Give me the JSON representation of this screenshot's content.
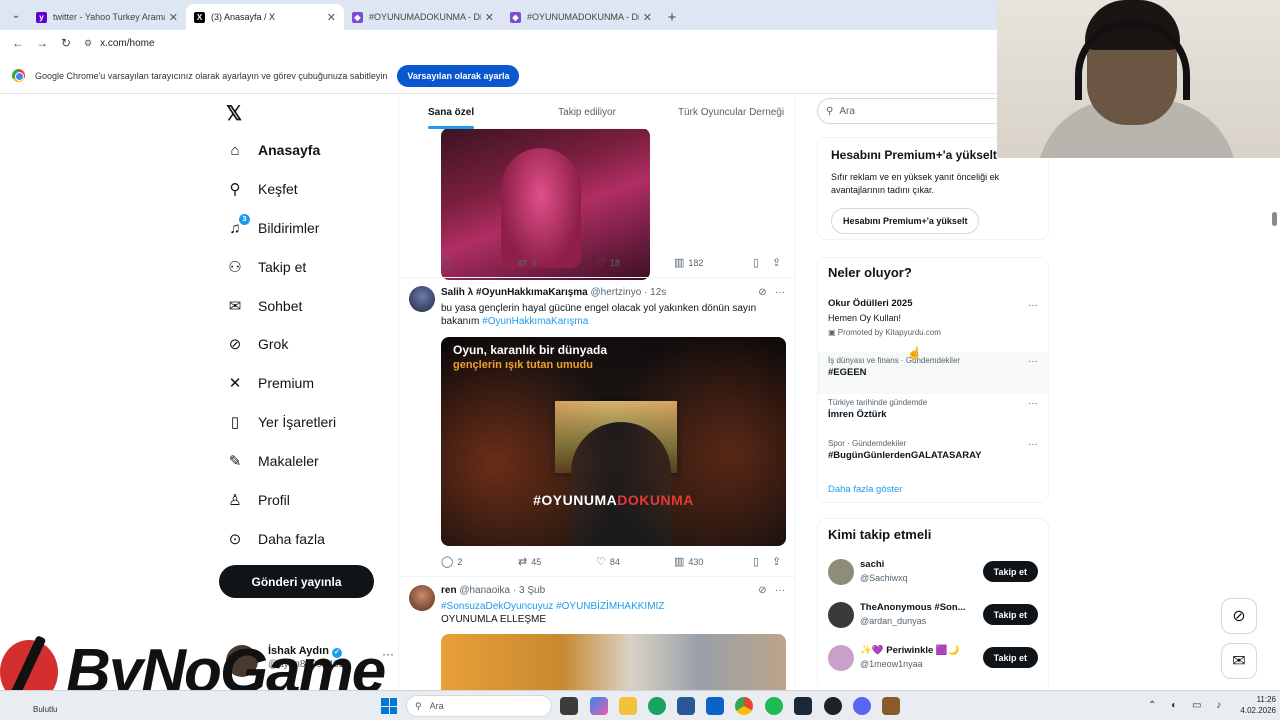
{
  "browser": {
    "tabs": [
      {
        "title": "twitter - Yahoo Turkey Arama Sonuçları",
        "favicon_color": "#6001d2",
        "favicon_glyph": "y!"
      },
      {
        "title": "(3) Anasayfa / X",
        "favicon_color": "#000000",
        "favicon_glyph": "X"
      },
      {
        "title": "#OYUNUMADOKUNMA - Dijital",
        "favicon_color": "#7a4fd6",
        "favicon_glyph": "🎮"
      },
      {
        "title": "#OYUNUMADOKUNMA - Dijital",
        "favicon_color": "#7a4fd6",
        "favicon_glyph": "🎮"
      }
    ],
    "url": "x.com/home",
    "infobar_text": "Google Chrome'u varsayılan tarayıcınız olarak ayarlayın ve görev çubuğunuza sabitleyin",
    "infobar_button": "Varsayılan olarak ayarla"
  },
  "nav": {
    "items": [
      {
        "label": "Anasayfa",
        "icon": "home-icon",
        "glyph": "⌂"
      },
      {
        "label": "Keşfet",
        "icon": "search-icon",
        "glyph": "⚲"
      },
      {
        "label": "Bildirimler",
        "icon": "bell-icon",
        "glyph": "🔔",
        "badge": "3"
      },
      {
        "label": "Takip et",
        "icon": "add-person-icon",
        "glyph": "👤"
      },
      {
        "label": "Sohbet",
        "icon": "mail-icon",
        "glyph": "✉"
      },
      {
        "label": "Grok",
        "icon": "grok-icon",
        "glyph": "⊘"
      },
      {
        "label": "Premium",
        "icon": "x-icon",
        "glyph": "X"
      },
      {
        "label": "Yer İşaretleri",
        "icon": "bookmark-icon",
        "glyph": "🔖"
      },
      {
        "label": "Makaleler",
        "icon": "article-icon",
        "glyph": "📝"
      },
      {
        "label": "Profil",
        "icon": "person-icon",
        "glyph": "👤"
      },
      {
        "label": "Daha fazla",
        "icon": "more-circle-icon",
        "glyph": "⋯"
      }
    ],
    "post_button": "Gönderi yayınla",
    "account": {
      "name": "İshak Aydın",
      "handle": "@aydn87993402"
    }
  },
  "timeline": {
    "tabs": [
      "Sana özel",
      "Takip ediliyor",
      "Türk Oyuncular Derneği"
    ],
    "post1_stats": {
      "replies": "",
      "reposts": "9",
      "likes": "18",
      "views": "182"
    },
    "post2": {
      "name": "Salih λ #OyunHakkımaKarışma",
      "handle": "@hertzinyo",
      "time": "12s",
      "text": "bu yasa gençlerin hayal gücüne engel olacak yol yakınken dönün sayın bakanım",
      "hashtag": "#OyunHakkımaKarışma",
      "media_caption_1": "Oyun, karanlık bir dünyada",
      "media_caption_2": "gençlerin ışık tutan umudu",
      "media_tag_a": "#OYUNUMA",
      "media_tag_b": "DOKUNMA",
      "stats": {
        "replies": "2",
        "reposts": "45",
        "likes": "84",
        "views": "430"
      }
    },
    "post3": {
      "name": "ren",
      "handle": "@hanaoika",
      "time": "3 Şub",
      "hashtags": "#SonsuzaDekOyuncuyuz #OYUNBİZİMHAKKIMIZ",
      "text": "OYUNUMLA ELLEŞME"
    }
  },
  "sidebar": {
    "search_placeholder": "Ara",
    "premium": {
      "title": "Hesabını Premium+'a yükselt",
      "desc": "Sıfır reklam ve en yüksek yanıt önceliği ek avantajlarının tadını çıkar.",
      "button": "Hesabını Premium+'a yükselt"
    },
    "trends_title": "Neler oluyor?",
    "ad": {
      "name": "Okur Ödülleri 2025",
      "sub": "Hemen Oy Kullan!",
      "promo": "Promoted by Kitapyurdu.com"
    },
    "trends": [
      {
        "category": "İş dünyası ve finans · Gündemdekiler",
        "name": "#EGEEN"
      },
      {
        "category": "Türkiye tarihinde gündemde",
        "name": "İmren Öztürk"
      },
      {
        "category": "Spor · Gündemdekiler",
        "name": "#BugünGünlerdenGALATASARAY"
      }
    ],
    "show_more": "Daha fazla göster",
    "who_title": "Kimi takip etmeli",
    "follow_button": "Takip et",
    "follows": [
      {
        "name": "sachi",
        "handle": "@Sachiwxq",
        "avatar_color": "#8d8d7a"
      },
      {
        "name": "TheAnonymous #Son...",
        "handle": "@ardan_dunyas",
        "avatar_color": "#3a3a3a"
      },
      {
        "name": "✨💜 Periwinkle 🟪🌙",
        "handle": "@1meow1nyaa",
        "avatar_color": "#c9a0c8"
      }
    ]
  },
  "taskbar": {
    "weather": "Bulutlu",
    "search_placeholder": "Ara",
    "time": "11:26",
    "date": "4.02.2026"
  },
  "watermark": "ByNoGame"
}
